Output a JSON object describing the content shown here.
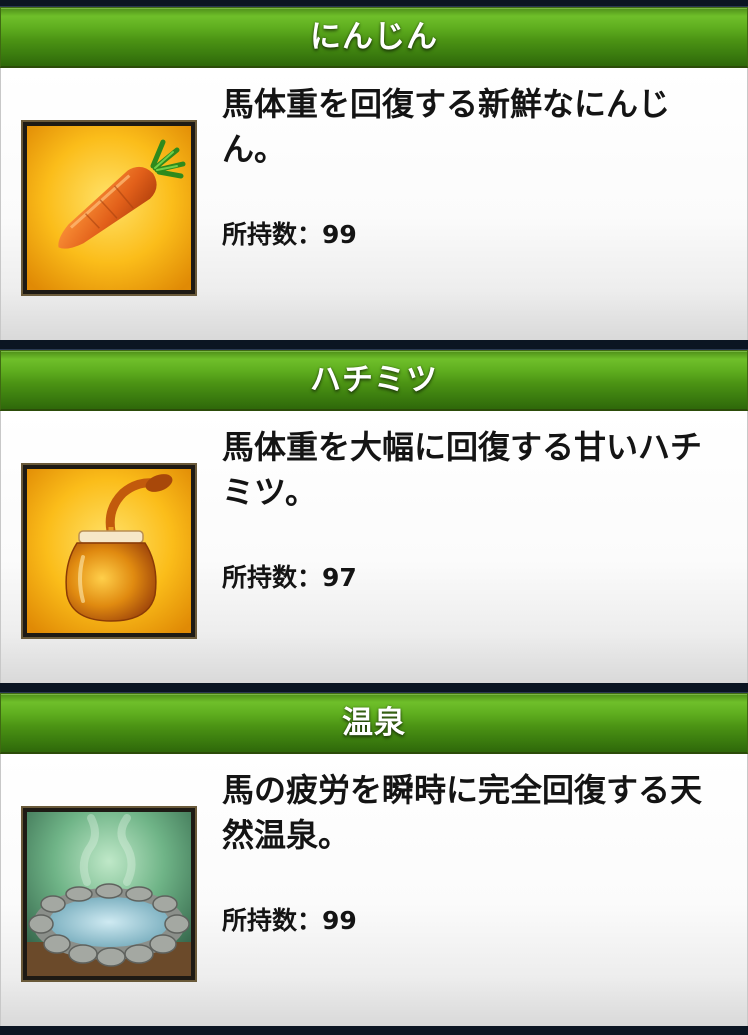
{
  "count_label": "所持数：",
  "items": [
    {
      "name": "にんじん",
      "description": "馬体重を回復する新鮮なにんじん。",
      "count": "99",
      "icon": "carrot-icon"
    },
    {
      "name": "ハチミツ",
      "description": "馬体重を大幅に回復する甘いハチミツ。",
      "count": "97",
      "icon": "honey-jar-icon"
    },
    {
      "name": "温泉",
      "description": "馬の疲労を瞬時に完全回復する天然温泉。",
      "count": "99",
      "icon": "hot-spring-icon"
    }
  ]
}
